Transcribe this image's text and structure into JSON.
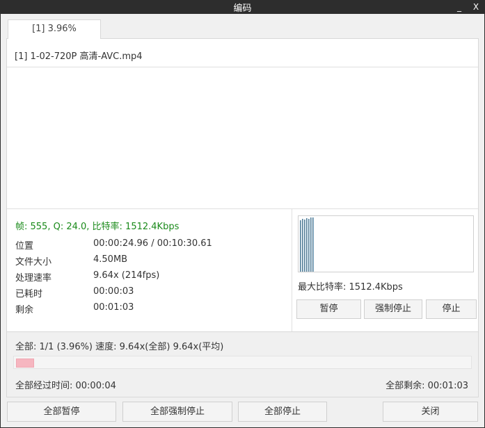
{
  "window": {
    "title": "编码",
    "minimize": "_",
    "close": "X"
  },
  "tab": {
    "label": "[1] 3.96%"
  },
  "file": {
    "name": "[1] 1-02-720P 高清-AVC.mp4"
  },
  "stats": {
    "frame_line": "帧: 555, Q: 24.0, 比特率: 1512.4Kbps",
    "rows": [
      {
        "label": "位置",
        "value": "00:00:24.96 / 00:10:30.61"
      },
      {
        "label": "文件大小",
        "value": "4.50MB"
      },
      {
        "label": "处理速率",
        "value": "9.64x (214fps)"
      },
      {
        "label": "已耗时",
        "value": "00:00:03"
      },
      {
        "label": "剩余",
        "value": "00:01:03"
      }
    ]
  },
  "bitrate_graph": {
    "max_label": "最大比特率: 1512.4Kbps",
    "bar_colors": {
      "fill": "#8fb3c9",
      "edge": "#5a7f96"
    }
  },
  "task_buttons": {
    "pause": "暂停",
    "force_stop": "强制停止",
    "stop": "停止"
  },
  "overall": {
    "summary": "全部: 1/1 (3.96%) 速度: 9.64x(全部) 9.64x(平均)",
    "progress_percent": 3.96,
    "elapsed": "全部经过时间: 00:00:04",
    "remaining": "全部剩余: 00:01:03"
  },
  "bottom_buttons": {
    "pause_all": "全部暂停",
    "force_stop_all": "全部强制停止",
    "stop_all": "全部停止",
    "close": "关闭"
  }
}
